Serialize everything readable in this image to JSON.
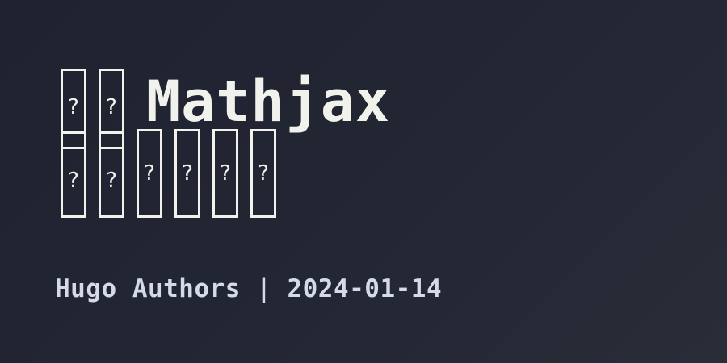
{
  "title": {
    "missing_glyph": "?",
    "text": "Mathjax"
  },
  "meta": {
    "author": "Hugo Authors",
    "separator": " | ",
    "date": "2024-01-14"
  },
  "colors": {
    "title": "#f2f2ec",
    "meta": "#d5dbe6",
    "background": "#222533"
  }
}
